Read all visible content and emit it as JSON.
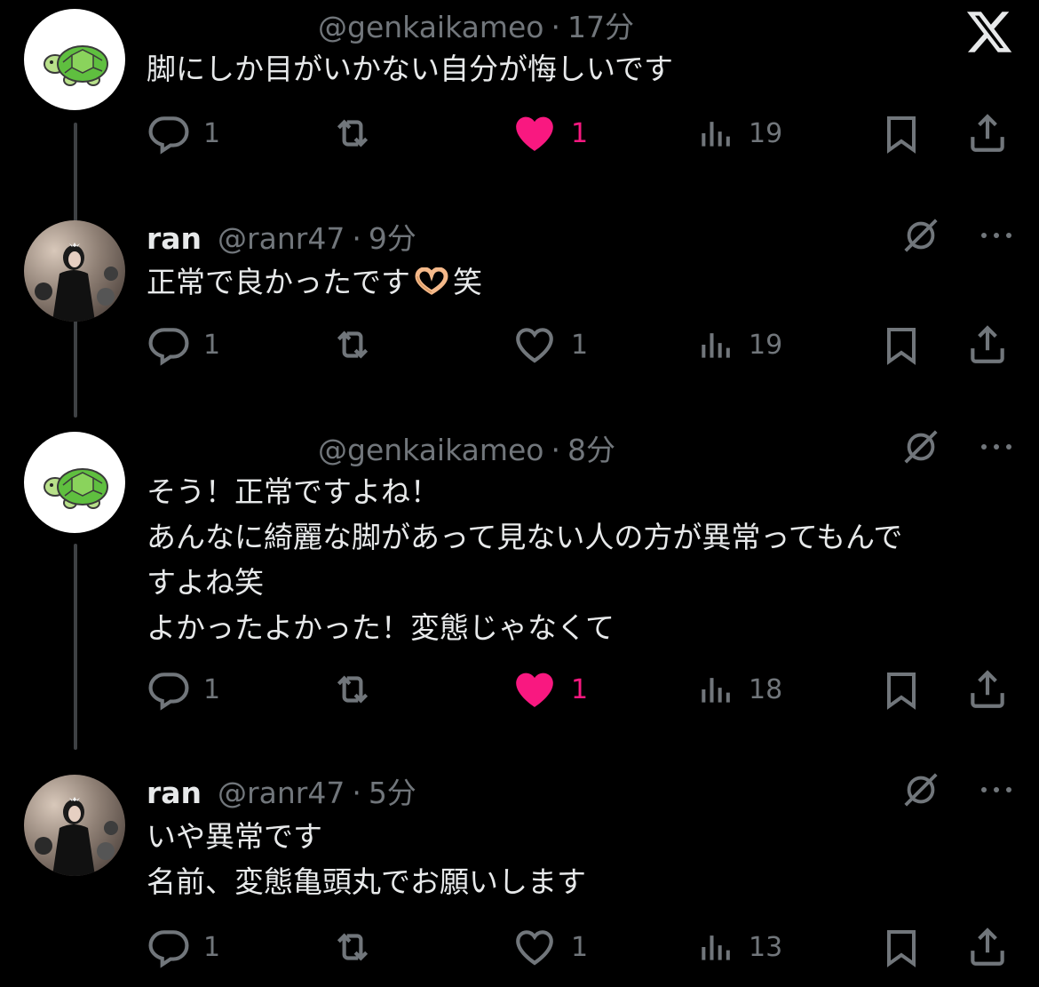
{
  "header": {
    "logo_icon": "x-logo-icon"
  },
  "posts": [
    {
      "avatar": "turtle-avatar",
      "name": "",
      "handle": "@genkaikameo",
      "separator": "·",
      "time": "17分",
      "lines": [
        "脚にしか目がいかない自分が悔しいです"
      ],
      "replies": "1",
      "likes": "1",
      "liked": true,
      "views": "19",
      "show_grok": false
    },
    {
      "avatar": "photo-avatar",
      "name": "ran",
      "handle": "@ranr47",
      "separator": "·",
      "time": "9分",
      "text_before_emoji": "正常で良かったです",
      "emoji": "heart-hands-emoji",
      "text_after_emoji": "笑",
      "replies": "1",
      "likes": "1",
      "liked": false,
      "views": "19",
      "show_grok": true
    },
    {
      "avatar": "turtle-avatar",
      "name": "",
      "handle": "@genkaikameo",
      "separator": "·",
      "time": "8分",
      "lines": [
        "そう！正常ですよね！",
        "あんなに綺麗な脚があって見ない人の方が異常ってもんで",
        "すよね笑",
        "よかったよかった！変態じゃなくて"
      ],
      "replies": "1",
      "likes": "1",
      "liked": true,
      "views": "18",
      "show_grok": true
    },
    {
      "avatar": "photo-avatar",
      "name": "ran",
      "handle": "@ranr47",
      "separator": "·",
      "time": "5分",
      "lines": [
        "いや異常です",
        "名前、変態亀頭丸でお願いします"
      ],
      "replies": "1",
      "likes": "1",
      "liked": false,
      "views": "13",
      "show_grok": true
    }
  ],
  "colors": {
    "background": "#000000",
    "text": "#e7e9ea",
    "secondary": "#71767b",
    "like": "#f91880",
    "thread_line": "#3e4144"
  }
}
